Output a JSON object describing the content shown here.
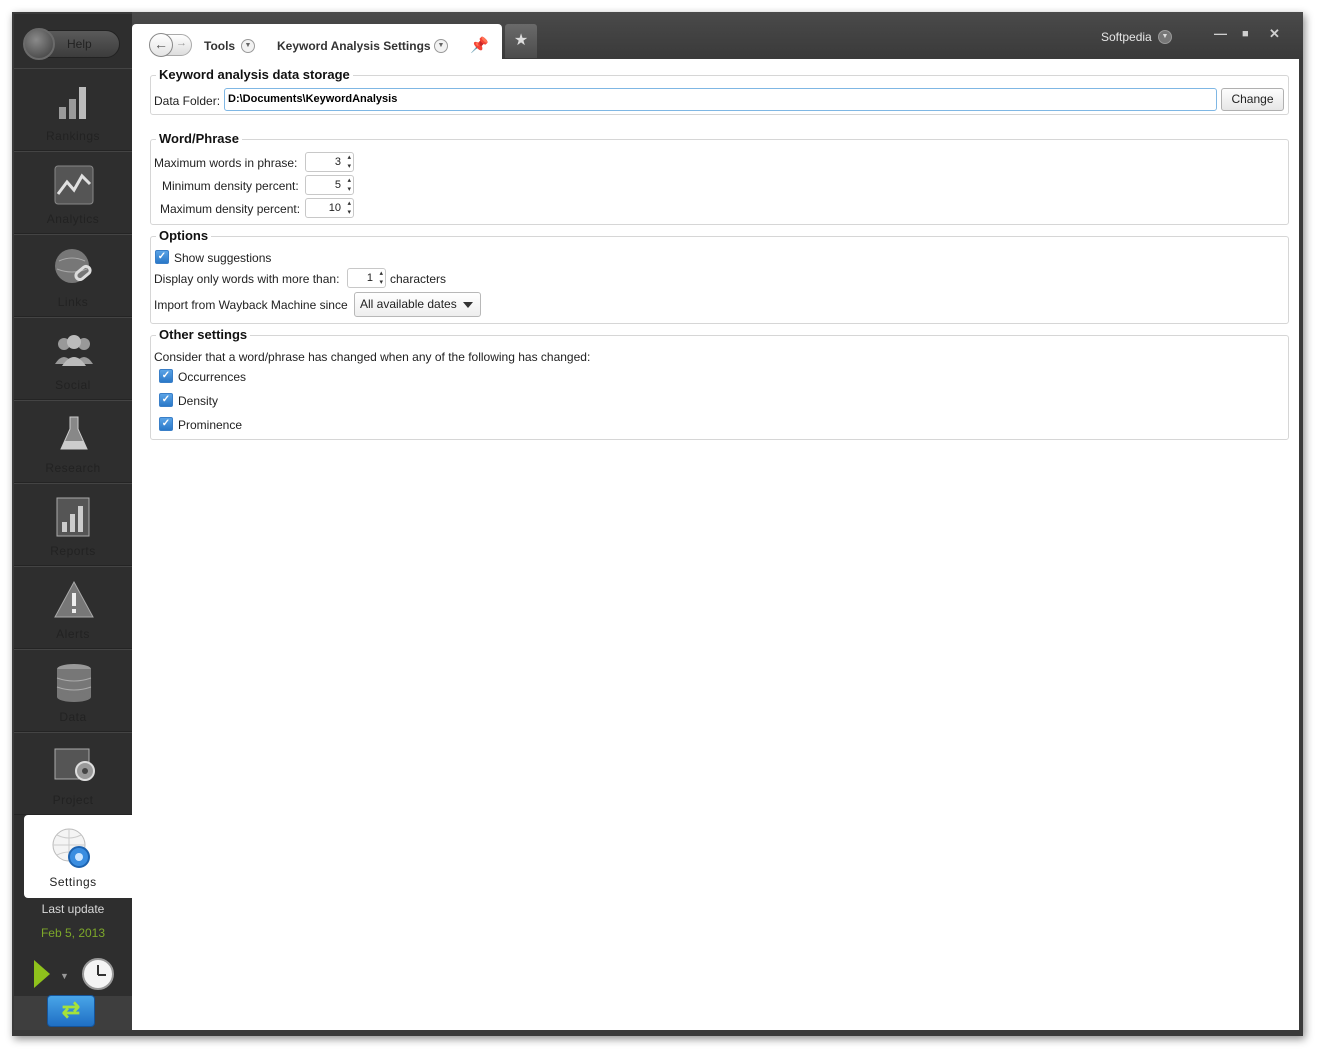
{
  "sidebar": {
    "help_label": "Help",
    "items": [
      {
        "label": "Rankings",
        "icon": "rankings-icon"
      },
      {
        "label": "Analytics",
        "icon": "analytics-icon"
      },
      {
        "label": "Links",
        "icon": "links-icon"
      },
      {
        "label": "Social",
        "icon": "social-icon"
      },
      {
        "label": "Research",
        "icon": "research-icon"
      },
      {
        "label": "Reports",
        "icon": "reports-icon"
      },
      {
        "label": "Alerts",
        "icon": "alerts-icon"
      },
      {
        "label": "Data",
        "icon": "data-icon"
      },
      {
        "label": "Project",
        "icon": "project-icon"
      },
      {
        "label": "Settings",
        "icon": "settings-icon",
        "active": true
      }
    ],
    "last_update_label": "Last update",
    "last_update_date": "Feb 5, 2013",
    "accent_date_color": "#7da82a"
  },
  "topbar": {
    "breadcrumb_tools": "Tools",
    "breadcrumb_page": "Keyword Analysis Settings",
    "user": "Softpedia",
    "minimize": "—",
    "maximize": "■",
    "close": "✕"
  },
  "storage": {
    "title": "Keyword analysis data storage",
    "folder_label": "Data Folder:",
    "folder_value": "D:\\Documents\\KeywordAnalysis",
    "change_button": "Change"
  },
  "word_phrase": {
    "title": "Word/Phrase",
    "max_words_label": "Maximum words in phrase:",
    "max_words_value": "3",
    "min_density_label": "Minimum density percent:",
    "min_density_value": "5",
    "max_density_label": "Maximum density percent:",
    "max_density_value": "10"
  },
  "options": {
    "title": "Options",
    "show_suggestions_label": "Show suggestions",
    "show_suggestions_checked": true,
    "min_chars_label": "Display only words with more than:",
    "min_chars_value": "1",
    "min_chars_suffix": "characters",
    "wayback_label": "Import from Wayback Machine since",
    "wayback_value": "All available dates"
  },
  "other": {
    "title": "Other settings",
    "description": "Consider that a word/phrase has changed when any of the following has changed:",
    "occurrences_label": "Occurrences",
    "density_label": "Density",
    "prominence_label": "Prominence"
  }
}
